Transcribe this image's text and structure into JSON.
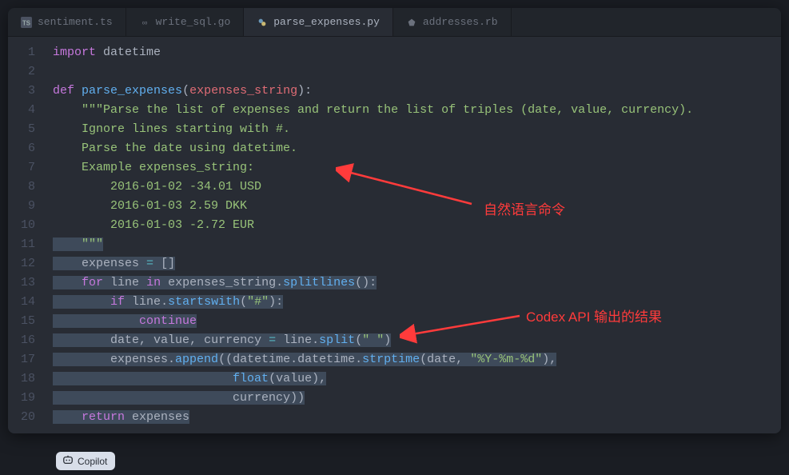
{
  "tabs": [
    {
      "icon": "ts-icon",
      "label": "sentiment.ts"
    },
    {
      "icon": "go-icon",
      "label": "write_sql.go"
    },
    {
      "icon": "py-icon",
      "label": "parse_expenses.py"
    },
    {
      "icon": "rb-icon",
      "label": "addresses.rb"
    }
  ],
  "activeTabIndex": 2,
  "code": {
    "l1_import": "import",
    "l1_module": "datetime",
    "l3_def": "def",
    "l3_fn": "parse_expenses",
    "l3_arg": "expenses_string",
    "l4": "    \"\"\"Parse the list of expenses and return the list of triples (date, value, currency).",
    "l5": "    Ignore lines starting with #.",
    "l6": "    Parse the date using datetime.",
    "l7": "    Example expenses_string:",
    "l8": "        2016-01-02 -34.01 USD",
    "l9": "        2016-01-03 2.59 DKK",
    "l10": "        2016-01-03 -2.72 EUR",
    "l11": "    \"\"\"",
    "l12_var": "expenses",
    "l13_for": "for",
    "l13_var": "line",
    "l13_in": "in",
    "l13_obj": "expenses_string",
    "l13_m": "splitlines",
    "l14_if": "if",
    "l14_obj": "line",
    "l14_m": "startswith",
    "l14_arg": "\"#\"",
    "l15_kw": "continue",
    "l16_a": "date",
    "l16_b": "value",
    "l16_c": "currency",
    "l16_obj": "line",
    "l16_m": "split",
    "l16_arg": "\" \"",
    "l17_obj": "expenses",
    "l17_m": "append",
    "l17_dt": "datetime.datetime",
    "l17_strp": "strptime",
    "l17_a": "date",
    "l17_fmt": "\"%Y-%m-%d\"",
    "l18_fn": "float",
    "l18_a": "value",
    "l19_a": "currency",
    "l20_ret": "return",
    "l20_var": "expenses"
  },
  "lineCount": 20,
  "annotations": {
    "a1": "自然语言命令",
    "a2": "Codex API 输出的结果"
  },
  "badge": "Copilot"
}
